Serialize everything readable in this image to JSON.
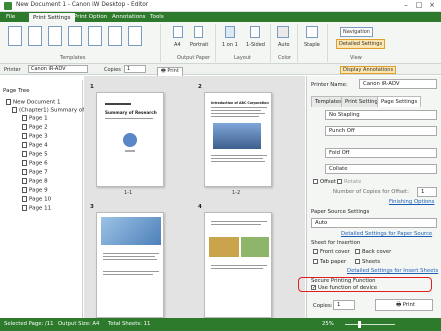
{
  "window": {
    "title": "New Document 1 - Canon iW Desktop - Editor"
  },
  "tabs": [
    "File",
    "Print Settings",
    "Print Option",
    "Annotations",
    "Tools"
  ],
  "ribbon": {
    "groups": [
      "Templates",
      "Output Paper",
      "Layout",
      "Color",
      "View"
    ],
    "paper_size": "A4",
    "orientation": "Portrait",
    "pages_per_sheet": "1 on 1",
    "sided": "1-Sided",
    "color": "Auto",
    "staple": "Staple",
    "navigation": "Navigation",
    "detailed_settings": "Detailed Settings"
  },
  "toolbar": {
    "printer_label": "Printer",
    "printer_value": "Canon iR-ADV",
    "copies_label": "Copies",
    "copies_value": "1",
    "print_label": "Print",
    "display_annotations": "Display Annotations"
  },
  "page_tree": {
    "header": "Page Tree",
    "items": [
      "New Document 1",
      "(Chapter1) Summary of R...",
      "Page 1",
      "Page 2",
      "Page 3",
      "Page 4",
      "Page 5",
      "Page 6",
      "Page 7",
      "Page 8",
      "Page 9",
      "Page 10",
      "Page 11"
    ]
  },
  "canvas": {
    "page_labels": [
      "1-1",
      "1-2"
    ],
    "page_numbers": [
      "1",
      "2",
      "3",
      "4"
    ],
    "page_headings": [
      "Summary of Research",
      "Introduction of ABC Corporation"
    ]
  },
  "right_panel": {
    "printer_name_label": "Printer Name:",
    "printer_name_value": "Canon iR-ADV",
    "tabs": [
      "Templates",
      "Print Settings",
      "Page Settings"
    ],
    "staple": "No Stapling",
    "punch": "Punch Off",
    "fold": "Fold Off",
    "collate": "Collate",
    "offset": "Offset",
    "rotate": "Rotate",
    "copies_for_offset": "Number of Copies for Offset:",
    "copies_for_offset_value": "1",
    "finishing_options": "Finishing Options",
    "paper_source_label": "Paper Source Settings",
    "paper_source_value": "Auto",
    "detailed_paper_source": "Detailed Settings for Paper Source",
    "sheet_insertion_label": "Sheet for Insertion",
    "front_cover": "Front cover",
    "back_cover": "Back cover",
    "tab_paper": "Tab paper",
    "sheets": "Sheets",
    "detailed_insert": "Detailed Settings for Insert Sheets",
    "secure_label": "Secure Printing Function",
    "use_function": "Use function of device",
    "copies_label": "Copies:",
    "copies_value": "1",
    "print_button": "Print"
  },
  "status": {
    "selected_page": "Selected Page: /11",
    "output_size": "Output Size: A4",
    "total_sheets": "Total Sheets: 11",
    "zoom": "25%"
  },
  "colors": {
    "accent": "#2d7a2d",
    "highlight": "#e02020"
  }
}
